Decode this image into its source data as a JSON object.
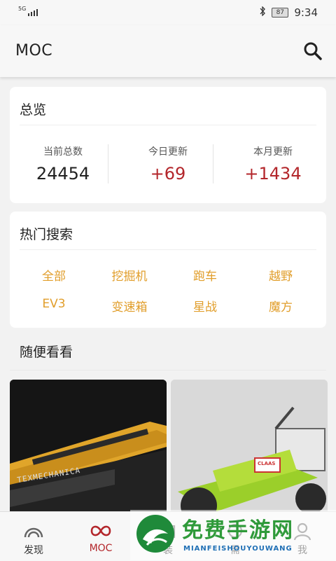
{
  "status_bar": {
    "network": "5G",
    "bluetooth_icon": "bluetooth-icon",
    "battery": "87",
    "time": "9:34"
  },
  "app_bar": {
    "title": "MOC",
    "search_icon": "search-icon"
  },
  "overview": {
    "title": "总览",
    "stats": [
      {
        "label": "当前总数",
        "value": "24454",
        "color": "#222222"
      },
      {
        "label": "今日更新",
        "value": "+69",
        "color": "#b3262b"
      },
      {
        "label": "本月更新",
        "value": "+1434",
        "color": "#b3262b"
      }
    ]
  },
  "hot_search": {
    "title": "热门搜索",
    "tags": [
      "全部",
      "挖掘机",
      "跑车",
      "越野",
      "EV3",
      "变速箱",
      "星战",
      "魔方"
    ],
    "tag_color": "#e19e2b"
  },
  "browse": {
    "title": "随便看看",
    "thumbnails": [
      {
        "caption_text": "TEXMECHANICA"
      },
      {
        "caption_text": "CLAAS"
      }
    ]
  },
  "tab_bar": {
    "tabs": [
      {
        "label": "发现",
        "icon": "rainbow-icon",
        "active": false
      },
      {
        "label": "MOC",
        "icon": "infinity-icon",
        "active": true
      },
      {
        "label": "装",
        "icon": "assemble-icon",
        "active": false
      },
      {
        "label": "需",
        "icon": "parts-icon",
        "active": false
      },
      {
        "label": "我",
        "icon": "profile-icon",
        "active": false
      }
    ],
    "active_color": "#b3262b"
  },
  "watermark": {
    "title": "免费手游网",
    "subtitle": "MIANFEISHOUYOUWANG"
  }
}
